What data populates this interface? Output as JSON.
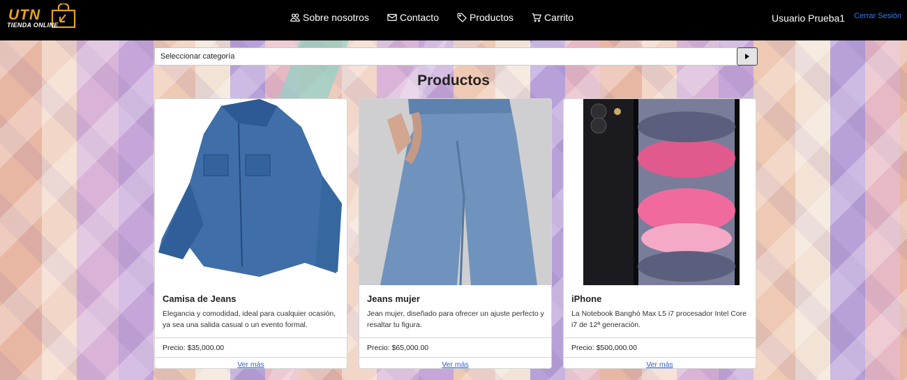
{
  "brand": {
    "logo_main": "UTN",
    "logo_sub": "TIENDA ONLINE",
    "accent": "#e8a21d"
  },
  "nav": {
    "items": [
      {
        "label": "Sobre nosotros",
        "icon": "users-icon"
      },
      {
        "label": "Contacto",
        "icon": "mail-icon"
      },
      {
        "label": "Productos",
        "icon": "tag-icon"
      },
      {
        "label": "Carrito",
        "icon": "cart-icon"
      }
    ],
    "user": "Usuario Prueba1",
    "logout": "Cerrar Sesión"
  },
  "filter": {
    "category_value": "Seleccionar categoría"
  },
  "page": {
    "title": "Productos"
  },
  "products": [
    {
      "name": "Camisa de Jeans",
      "description": "Elegancia y comodidad, ideal para cualquier ocasión, ya sea una salida casual o un evento formal.",
      "price": "Precio: $35,000.00",
      "more": "Ver más",
      "image": "denim-shirt-image"
    },
    {
      "name": "Jeans mujer",
      "description": "Jean mujer, diseñado para ofrecer un ajuste perfecto y resaltar tu figura.",
      "price": "Precio: $65,000.00",
      "more": "Ver más",
      "image": "jeans-image"
    },
    {
      "name": "iPhone",
      "description": "La Notebook Banghó Max L5 i7 procesador Intel Core i7 de 12ª generación.",
      "price": "Precio: $500,000.00",
      "more": "Ver más",
      "image": "iphone-image"
    }
  ]
}
